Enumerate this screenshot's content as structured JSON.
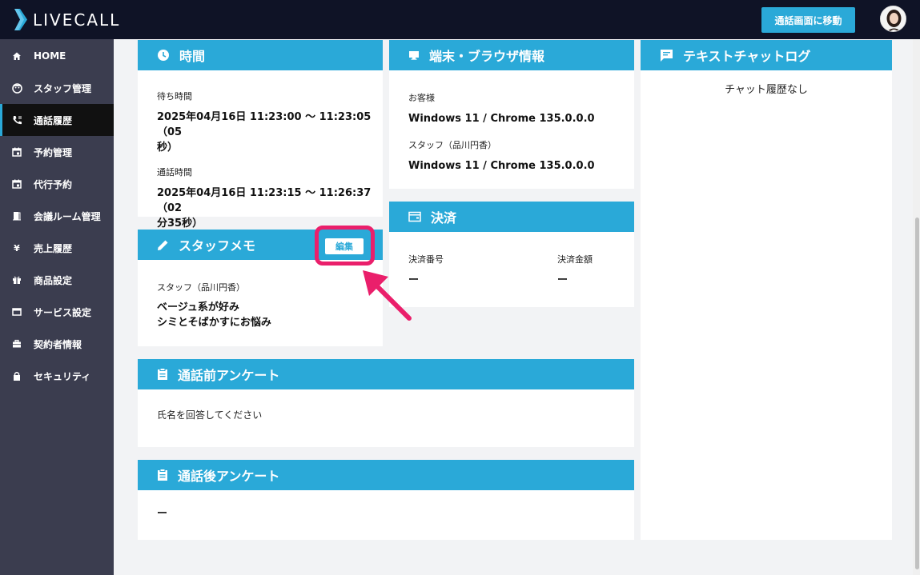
{
  "header": {
    "logo_text": "LIVECALL",
    "move_button_label": "通話画面に移動"
  },
  "sidebar": {
    "items": [
      {
        "label": "HOME",
        "icon": "home-icon"
      },
      {
        "label": "スタッフ管理",
        "icon": "face-icon"
      },
      {
        "label": "通話履歴",
        "icon": "phone-log-icon",
        "active": true
      },
      {
        "label": "予約管理",
        "icon": "calendar-icon"
      },
      {
        "label": "代行予約",
        "icon": "calendar-icon"
      },
      {
        "label": "会議ルーム管理",
        "icon": "door-icon"
      },
      {
        "label": "売上履歴",
        "icon": "yen-icon"
      },
      {
        "label": "商品設定",
        "icon": "gift-icon"
      },
      {
        "label": "サービス設定",
        "icon": "window-icon"
      },
      {
        "label": "契約者情報",
        "icon": "briefcase-icon"
      },
      {
        "label": "セキュリティ",
        "icon": "lock-icon"
      }
    ]
  },
  "time_card": {
    "title": "時間",
    "wait_label": "待ち時間",
    "wait_value_line1": "2025年04月16日 11:23:00 〜 11:23:05（05",
    "wait_value_line2": "秒）",
    "call_label": "通話時間",
    "call_value_line1": "2025年04月16日 11:23:15 〜 11:26:37（02",
    "call_value_line2": "分35秒）"
  },
  "device_card": {
    "title": "端末・ブラウザ情報",
    "customer_label": "お客様",
    "customer_value": "Windows 11 / Chrome 135.0.0.0",
    "staff_label": "スタッフ（品川円香）",
    "staff_value": "Windows 11 / Chrome 135.0.0.0"
  },
  "chat_card": {
    "title": "テキストチャットログ",
    "empty_text": "チャット履歴なし"
  },
  "memo_card": {
    "title": "スタッフメモ",
    "edit_label": "編集",
    "author": "スタッフ（品川円香）",
    "line1": "ベージュ系が好み",
    "line2": "シミとそばかすにお悩み"
  },
  "payment_card": {
    "title": "決済",
    "number_label": "決済番号",
    "number_value": "ー",
    "amount_label": "決済金額",
    "amount_value": "ー"
  },
  "pre_survey": {
    "title": "通話前アンケート",
    "text": "氏名を回答してください"
  },
  "post_survey": {
    "title": "通話後アンケート",
    "text": "ー"
  },
  "colors": {
    "accent": "#2aa9d8",
    "topbar": "#0f1326",
    "sidebar": "#3b3d4f",
    "highlight": "#ea1f6b"
  }
}
